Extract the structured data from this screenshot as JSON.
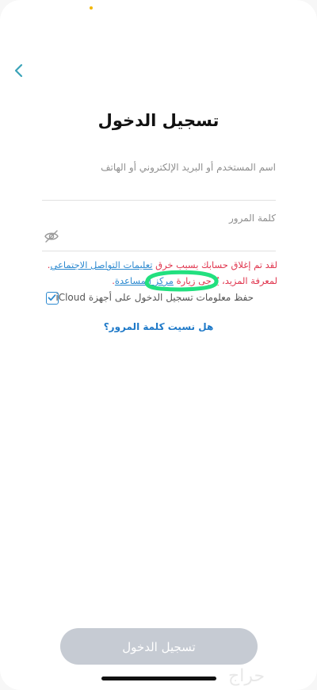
{
  "header": {
    "back_icon": "chevron-left-icon",
    "title": "تسجيل الدخول"
  },
  "form": {
    "username_label": "اسم المستخدم أو البريد الإلكتروني أو الهاتف",
    "username_value": "",
    "password_label": "كلمة المرور",
    "password_value": "",
    "password_toggle_icon": "eye-slash-icon",
    "error": {
      "part1": "لقد تم إغلاق حسابك بسبب خرق ",
      "link1": "تعليمات التواصل الاجتماعي",
      "part2": ". لمعرفة المزيد، يُرجى زيارة ",
      "link2": "مركز المساعدة",
      "part3": "."
    },
    "remember_label": "حفظ معلومات تسجيل الدخول على أجهزة iCloud",
    "remember_checked": true,
    "forgot_password": "هل نسيت كلمة المرور؟"
  },
  "footer": {
    "login_button": "تسجيل الدخول",
    "watermark": "حراج"
  },
  "colors": {
    "accent": "#2d8ad0",
    "error": "#e0344d",
    "button_disabled": "#c6cbd3",
    "highlight": "#22e07f"
  }
}
